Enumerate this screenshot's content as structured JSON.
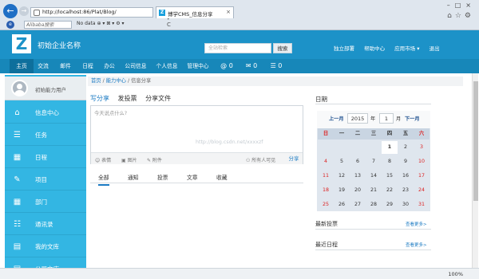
{
  "browser": {
    "url": "http://localhost:86/Plat/Blog/",
    "url_tools": "ρ ▾ C",
    "tab_title": "博学CMS_信息分享",
    "search_placeholder": "Alibaba搜索",
    "toolbar_items": "No data  ⊕  ▾  ⊠ ▾  ⚙ ▾",
    "zoom": "100%"
  },
  "header": {
    "logo": "Z",
    "company": "初始企业名称",
    "search_placeholder": "全站检索",
    "search_button": "搜索",
    "links": [
      "独立部署",
      "帮助中心",
      "应用市场 ▾",
      "退出"
    ]
  },
  "nav": {
    "items": [
      "主页",
      "交流",
      "邮件",
      "日程",
      "办公",
      "公司信息",
      "个人信息",
      "管理中心"
    ],
    "badges": [
      "@ 0",
      "✉ 0",
      "☰ 0"
    ]
  },
  "sidebar": {
    "user": "初始能力用户",
    "items": [
      "信息中心",
      "任务",
      "日程",
      "项目",
      "部门",
      "通讯录",
      "我的文库",
      "公司文库"
    ]
  },
  "breadcrumb": [
    "首页",
    "能力中心",
    "信息分享"
  ],
  "compose": {
    "tabs": [
      "写分享",
      "发投票",
      "分享文件"
    ],
    "placeholder": "今天说点什么?",
    "tools": [
      "☺ 表情",
      "▣ 图片",
      "✎ 附件"
    ],
    "visibility": "⚇ 所有人可见",
    "share_button": "分享"
  },
  "feed_tabs": [
    "全部",
    "通知",
    "投票",
    "文章",
    "收藏"
  ],
  "watermark": "http://blog.csdn.net/xxxxzf",
  "calendar": {
    "title": "日期",
    "prev": "上一月",
    "year": "2015",
    "year_label": "年",
    "month": "1",
    "month_label": "月",
    "next": "下一月",
    "weekdays": [
      "日",
      "一",
      "二",
      "三",
      "四",
      "五",
      "六"
    ],
    "rows": [
      [
        "",
        "",
        "",
        "",
        "1",
        "2",
        "3"
      ],
      [
        "4",
        "5",
        "6",
        "7",
        "8",
        "9",
        "10"
      ],
      [
        "11",
        "12",
        "13",
        "14",
        "15",
        "16",
        "17"
      ],
      [
        "18",
        "19",
        "20",
        "21",
        "22",
        "23",
        "24"
      ],
      [
        "25",
        "26",
        "27",
        "28",
        "29",
        "30",
        "31"
      ]
    ],
    "today": "1"
  },
  "right": {
    "votes_title": "最新投票",
    "recent_title": "最近日程",
    "more": "查看更多>"
  }
}
